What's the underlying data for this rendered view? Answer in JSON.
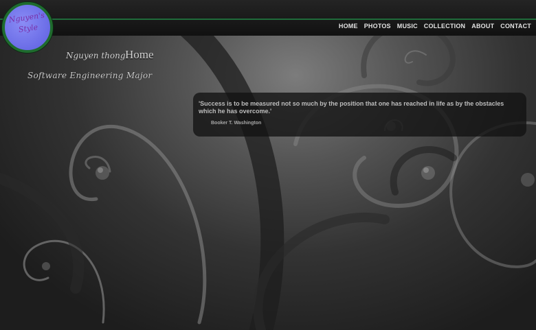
{
  "logo": {
    "text": "Nguyen's\nStyle"
  },
  "nav": {
    "items": [
      {
        "label": "HOME"
      },
      {
        "label": "PHOTOS"
      },
      {
        "label": "MUSIC"
      },
      {
        "label": "COLLECTION"
      },
      {
        "label": "ABOUT"
      },
      {
        "label": "CONTACT"
      }
    ]
  },
  "header": {
    "name": "Nguyen thong",
    "page_title": "Home",
    "major": "Software Engineering Major"
  },
  "quote": {
    "text": "'Success is to be measured not so much by the position that one has reached in life as by the obstacles which he has overcome.'",
    "author": "Booker T. Washington"
  },
  "colors": {
    "accent_green": "#1f6b3a",
    "logo_fill": "#6e70ea",
    "logo_text": "#7a2fa8"
  }
}
